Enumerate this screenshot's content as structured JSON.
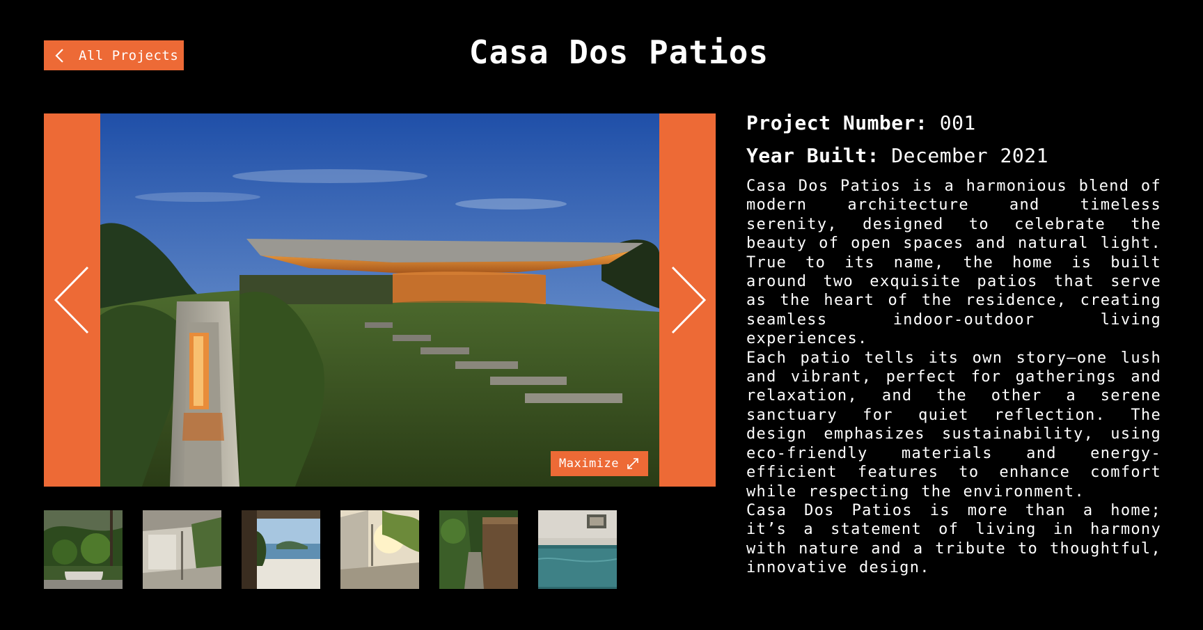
{
  "header": {
    "back_label": "All Projects",
    "title": "Casa Dos Patios"
  },
  "viewer": {
    "prev_icon": "chevron-left-icon",
    "next_icon": "chevron-right-icon",
    "maximize_label": "Maximize",
    "maximize_icon": "expand-arrows-icon"
  },
  "thumbnails": [
    {
      "name": "bathroom-tropical"
    },
    {
      "name": "interior-corridor"
    },
    {
      "name": "beach-view"
    },
    {
      "name": "sunlit-terrace"
    },
    {
      "name": "garden-path"
    },
    {
      "name": "pool-aerial"
    }
  ],
  "info": {
    "project_number_label": "Project Number:",
    "project_number": "001",
    "year_label": "Year Built:",
    "year": "December 2021",
    "paragraphs": [
      "Casa Dos Patios is a harmonious blend of modern architecture and timeless serenity, designed to celebrate the beauty of open spaces and natural light. True to its name, the home is built around two exquisite patios that serve as the heart of the residence, creating seamless indoor-outdoor living experiences.",
      "Each patio tells its own story—one lush and vibrant, perfect for gatherings and relaxation, and the other a serene sanctuary for quiet reflection. The design emphasizes sustainability, using eco-friendly materials and energy-efficient features to enhance comfort while respecting the environment.",
      "Casa Dos Patios is more than a home; it’s a statement of living in harmony with nature and a tribute to thoughtful, innovative design."
    ]
  },
  "colors": {
    "accent": "#ed6a36",
    "background": "#000000",
    "text": "#ffffff"
  }
}
